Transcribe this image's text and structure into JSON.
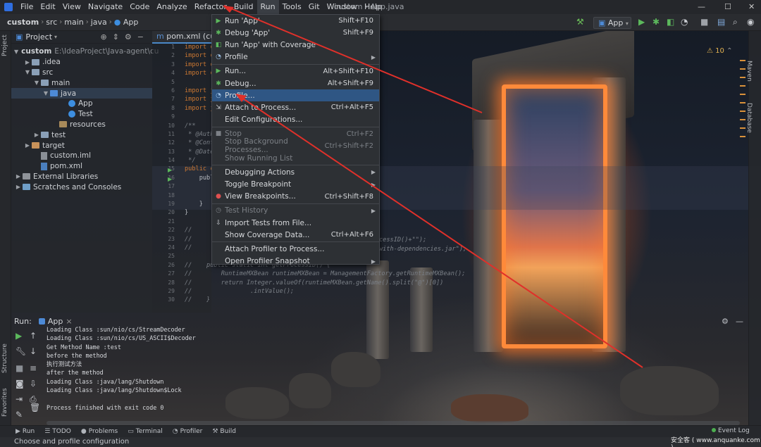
{
  "menubar": {
    "items": [
      "File",
      "Edit",
      "View",
      "Navigate",
      "Code",
      "Analyze",
      "Refactor",
      "Build",
      "Run",
      "Tools",
      "Git",
      "Window",
      "Help"
    ],
    "active": "Run",
    "window_title": "custom - App.java"
  },
  "breadcrumb": [
    "custom",
    "src",
    "main",
    "java",
    "App"
  ],
  "run_config": "App",
  "project_panel": {
    "title": "Project",
    "tree": [
      {
        "label": "custom",
        "path": "E:\\IdeaProject\\Java-agent\\cu",
        "indent": 0,
        "kind": "module"
      },
      {
        "label": ".idea",
        "indent": 1,
        "kind": "folder"
      },
      {
        "label": "src",
        "indent": 1,
        "kind": "folder"
      },
      {
        "label": "main",
        "indent": 2,
        "kind": "folder"
      },
      {
        "label": "java",
        "indent": 3,
        "kind": "folder-blue"
      },
      {
        "label": "App",
        "indent": 5,
        "kind": "class"
      },
      {
        "label": "Test",
        "indent": 5,
        "kind": "class"
      },
      {
        "label": "resources",
        "indent": 4,
        "kind": "folder-res"
      },
      {
        "label": "test",
        "indent": 2,
        "kind": "folder"
      },
      {
        "label": "target",
        "indent": 1,
        "kind": "folder-orange"
      },
      {
        "label": "custom.iml",
        "indent": 2,
        "kind": "file"
      },
      {
        "label": "pom.xml",
        "indent": 2,
        "kind": "file-m"
      },
      {
        "label": "External Libraries",
        "indent": 0,
        "kind": "lib"
      },
      {
        "label": "Scratches and Consoles",
        "indent": 0,
        "kind": "scratch"
      }
    ]
  },
  "editor": {
    "tab": "pom.xml (custo",
    "line_numbers": [
      "1",
      "2",
      "3",
      "4",
      "5",
      "6",
      "7",
      "8",
      "9",
      "10",
      "11",
      "12",
      "13",
      "14",
      "15",
      "16",
      "17",
      "18",
      "19",
      "20",
      "21",
      "22",
      "23",
      "24",
      "25",
      "26",
      "27",
      "28",
      "29",
      "30"
    ],
    "code_lines": [
      "import c",
      "import c",
      "import c",
      "import c",
      "",
      "import j",
      "import j",
      "import j",
      "",
      "/**",
      " * @Auth",
      " * @Cont",
      " * @Date",
      " */",
      "public c",
      "    publ",
      "",
      "",
      "    }",
      "}",
      "",
      "//",
      "//",
      "//",
      "",
      "//    public static int getProcessID() {",
      "//        RuntimeMXBean runtimeMXBean = ManagementFactory.getRuntimeMXBean();",
      "//        return Integer.valueOf(runtimeMXBean.getName().split(\"@\")[0])",
      "//                .intValue();",
      "//    }"
    ],
    "right_fragments": [
      "cessID()+\"\");",
      "with-dependencies.jar\");"
    ],
    "warnings": "10"
  },
  "run_menu": {
    "items": [
      {
        "label": "Run 'App'",
        "shortcut": "Shift+F10",
        "icon": "run-icon"
      },
      {
        "label": "Debug 'App'",
        "shortcut": "Shift+F9",
        "icon": "debug-icon"
      },
      {
        "label": "Run 'App' with Coverage",
        "shortcut": "",
        "icon": "coverage-icon"
      },
      {
        "label": "Profile",
        "shortcut": "",
        "icon": "profile-icon",
        "submenu": true
      },
      {
        "sep": true
      },
      {
        "label": "Run...",
        "shortcut": "Alt+Shift+F10",
        "icon": "run-icon"
      },
      {
        "label": "Debug...",
        "shortcut": "Alt+Shift+F9",
        "icon": "debug-icon"
      },
      {
        "label": "Profile...",
        "shortcut": "",
        "icon": "profile-icon",
        "highlighted": true
      },
      {
        "label": "Attach to Process...",
        "shortcut": "Ctrl+Alt+F5",
        "icon": "attach-icon"
      },
      {
        "label": "Edit Configurations...",
        "shortcut": "",
        "icon": ""
      },
      {
        "sep": true
      },
      {
        "label": "Stop",
        "shortcut": "Ctrl+F2",
        "icon": "stop-icon",
        "disabled": true
      },
      {
        "label": "Stop Background Processes...",
        "shortcut": "Ctrl+Shift+F2",
        "icon": "",
        "disabled": true
      },
      {
        "label": "Show Running List",
        "shortcut": "",
        "icon": "",
        "disabled": true
      },
      {
        "sep": true
      },
      {
        "label": "Debugging Actions",
        "shortcut": "",
        "icon": "",
        "submenu": true
      },
      {
        "label": "Toggle Breakpoint",
        "shortcut": "",
        "icon": "",
        "submenu": true
      },
      {
        "label": "View Breakpoints...",
        "shortcut": "Ctrl+Shift+F8",
        "icon": "breakpoints-icon"
      },
      {
        "sep": true
      },
      {
        "label": "Test History",
        "shortcut": "",
        "icon": "history-icon",
        "submenu": true,
        "disabled": true
      },
      {
        "label": "Import Tests from File...",
        "shortcut": "",
        "icon": "import-icon"
      },
      {
        "label": "Show Coverage Data...",
        "shortcut": "Ctrl+Alt+F6",
        "icon": ""
      },
      {
        "sep": true
      },
      {
        "label": "Attach Profiler to Process...",
        "shortcut": "",
        "icon": ""
      },
      {
        "label": "Open Profiler Snapshot",
        "shortcut": "",
        "icon": "",
        "submenu": true
      }
    ]
  },
  "run_panel": {
    "label": "Run:",
    "tab": "App",
    "console": [
      "Loading Class :sun/nio/cs/StreamDecoder",
      "Loading Class :sun/nio/cs/US_ASCII$Decoder",
      "Get Method Name :test",
      "before the method",
      "执行测试方法",
      "after the method",
      "Loading Class :java/lang/Shutdown",
      "Loading Class :java/lang/Shutdown$Lock",
      "",
      "Process finished with exit code 0"
    ]
  },
  "tool_windows": [
    "Run",
    "TODO",
    "Problems",
    "Terminal",
    "Profiler",
    "Build"
  ],
  "left_strip": [
    "Project",
    "Structure",
    "Favorites"
  ],
  "right_strip": [
    "Maven",
    "Database"
  ],
  "event_log": "Event Log",
  "status_text": "Choose and profile configuration",
  "watermark": "安全客 ( www.anquanke.com )",
  "colors": {
    "menu_highlight": "#2f5684",
    "accent": "#4a88c7",
    "annotation": "#e0302a"
  }
}
